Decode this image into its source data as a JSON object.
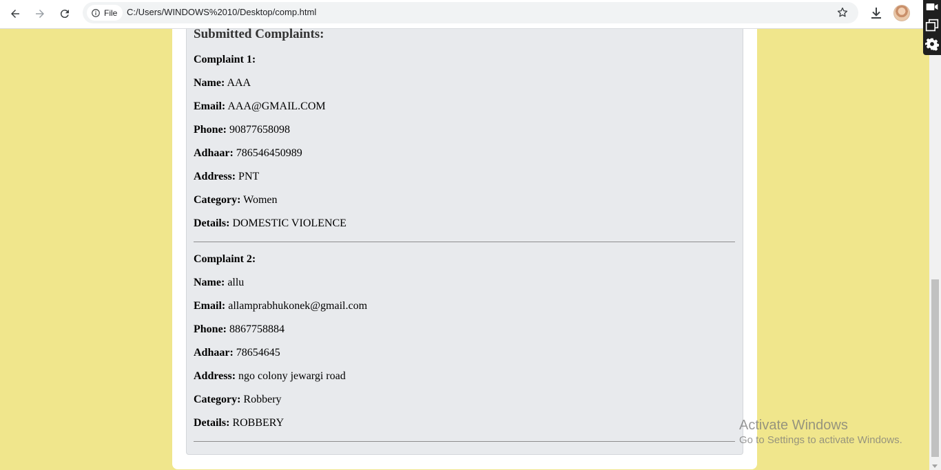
{
  "browser": {
    "chip_label": "File",
    "url": "C:/Users/WINDOWS%2010/Desktop/comp.html"
  },
  "icons": [
    "back-arrow-icon",
    "forward-arrow-icon",
    "reload-icon",
    "info-icon",
    "star-icon",
    "download-icon",
    "video-camera-icon",
    "picture-in-picture-icon",
    "gear-icon"
  ],
  "colors": {
    "page_background": "#f0e68c",
    "panel_background": "#e8eaed",
    "card_background": "#ffffff"
  },
  "page": {
    "heading": "Submitted Complaints:",
    "complaints": [
      {
        "title": "Complaint 1:",
        "fields": [
          {
            "label": "Name:",
            "value": "AAA"
          },
          {
            "label": "Email:",
            "value": "AAA@GMAIL.COM"
          },
          {
            "label": "Phone:",
            "value": "90877658098"
          },
          {
            "label": "Adhaar:",
            "value": "786546450989"
          },
          {
            "label": "Address:",
            "value": "PNT"
          },
          {
            "label": "Category:",
            "value": "Women"
          },
          {
            "label": "Details:",
            "value": "DOMESTIC VIOLENCE"
          }
        ]
      },
      {
        "title": "Complaint 2:",
        "fields": [
          {
            "label": "Name:",
            "value": "allu"
          },
          {
            "label": "Email:",
            "value": "allamprabhukonek@gmail.com"
          },
          {
            "label": "Phone:",
            "value": "8867758884"
          },
          {
            "label": "Adhaar:",
            "value": "78654645"
          },
          {
            "label": "Address:",
            "value": "ngo colony jewargi road"
          },
          {
            "label": "Category:",
            "value": "Robbery"
          },
          {
            "label": "Details:",
            "value": "ROBBERY"
          }
        ]
      }
    ]
  },
  "watermark": {
    "title": "Activate Windows",
    "subtitle": "Go to Settings to activate Windows."
  }
}
